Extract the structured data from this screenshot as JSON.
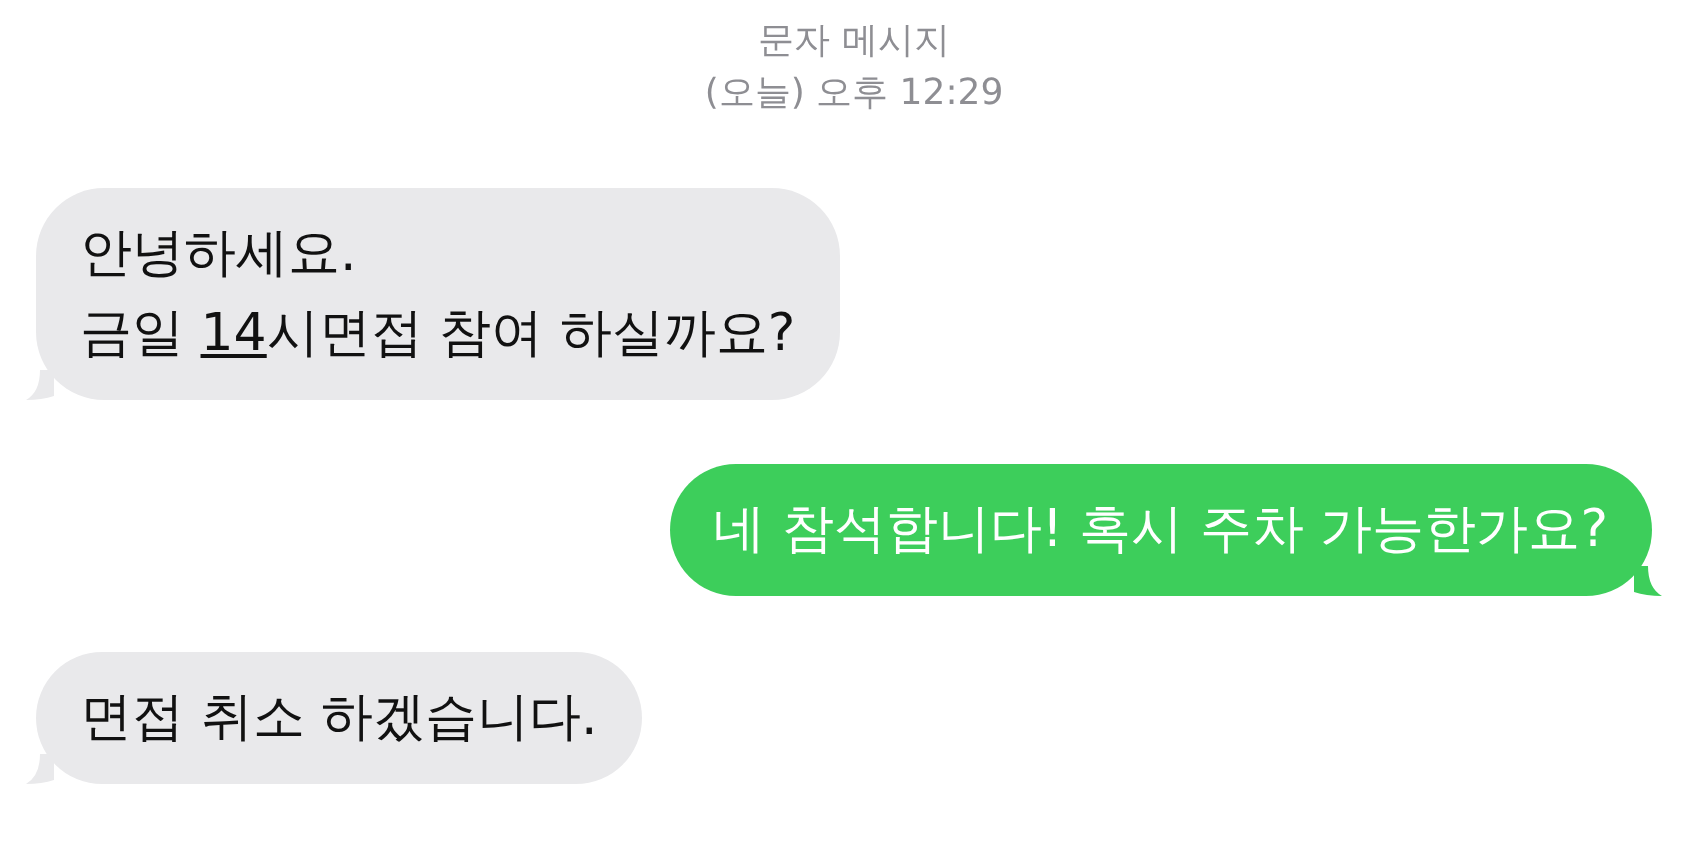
{
  "header": {
    "service": "문자 메시지",
    "timestamp": "(오늘) 오후 12:29"
  },
  "messages": [
    {
      "kind": "received",
      "segments": [
        {
          "text": "안녕하세요.\n금일 ",
          "link": false
        },
        {
          "text": "14",
          "link": true
        },
        {
          "text": "시면접 참여 하실까요?",
          "link": false
        }
      ]
    },
    {
      "kind": "sent",
      "segments": [
        {
          "text": "네 참석합니다! 혹시 주차 가능한가요?",
          "link": false
        }
      ]
    },
    {
      "kind": "received",
      "segments": [
        {
          "text": "면접 취소 하겠습니다.",
          "link": false
        }
      ]
    }
  ]
}
